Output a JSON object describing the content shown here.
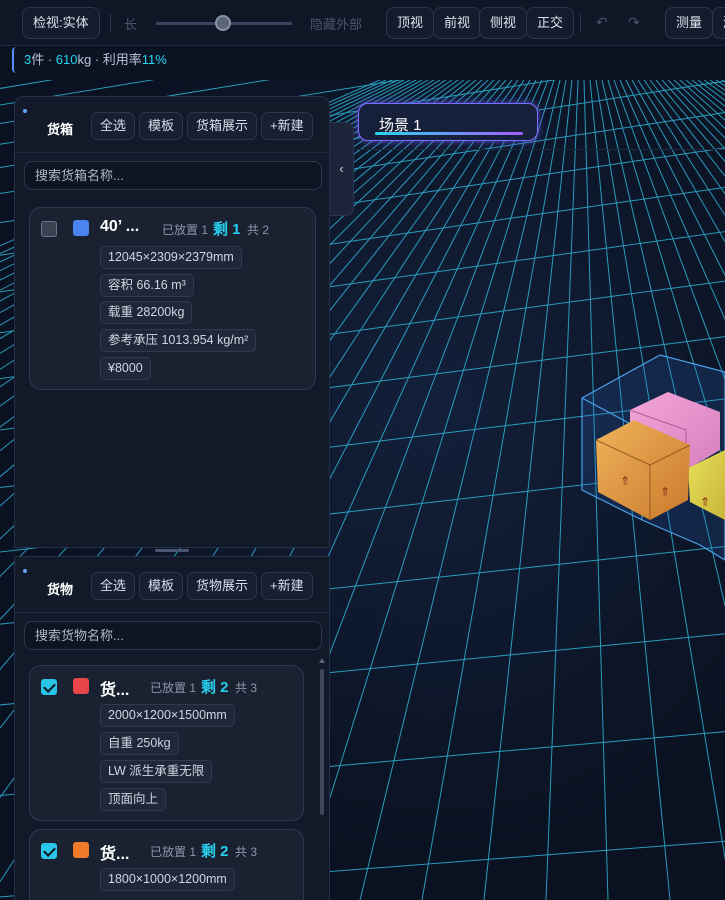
{
  "toolbar": {
    "view_mode": "检视:实体",
    "length_label": "长",
    "hide_outer": "隐藏外部",
    "top_view": "顶视",
    "front_view": "前视",
    "side_view": "侧视",
    "ortho": "正交",
    "measure": "测量"
  },
  "status": {
    "items_count": "3",
    "items_unit": "件 · ",
    "weight": "610",
    "weight_unit": "kg · 利用率",
    "utilization": "11%"
  },
  "scene": {
    "tab_label": "场景 1"
  },
  "container_panel": {
    "title": "货箱",
    "select_all": "全选",
    "template": "模板",
    "showcase": "货箱展示",
    "new": "+新建",
    "search_placeholder": "搜索货箱名称...",
    "cards": [
      {
        "checked": false,
        "color": "#4a84f0",
        "name": "40’ ...",
        "placed": "已放置 1",
        "remaining": "剩 1",
        "total": "共 2",
        "tags": [
          "12045×2309×2379mm",
          "容积 66.16 m³",
          "载重 28200kg",
          "参考承压 1013.954 kg/m²",
          "¥8000"
        ]
      }
    ]
  },
  "cargo_panel": {
    "title": "货物",
    "select_all": "全选",
    "template": "模板",
    "showcase": "货物展示",
    "new": "+新建",
    "search_placeholder": "搜索货物名称...",
    "cards": [
      {
        "checked": true,
        "color": "#e8464a",
        "name": "货...",
        "placed": "已放置 1",
        "remaining": "剩 2",
        "total": "共 3",
        "tags": [
          "2000×1200×1500mm",
          "自重 250kg",
          "LW 派生承重无限",
          "顶面向上"
        ]
      },
      {
        "checked": true,
        "color": "#f07a2a",
        "name": "货...",
        "placed": "已放置 1",
        "remaining": "剩 2",
        "total": "共 3",
        "tags": [
          "1800×1000×1200mm"
        ]
      }
    ]
  },
  "colors": {
    "accent": "#26d0ee",
    "tab_border": "#7c6cff",
    "grid": "#39c6e6"
  },
  "icons": {
    "collapse": "chevron-left-icon",
    "undo": "undo-icon",
    "redo": "redo-icon",
    "arrow_up": "arrow-up-icon"
  }
}
